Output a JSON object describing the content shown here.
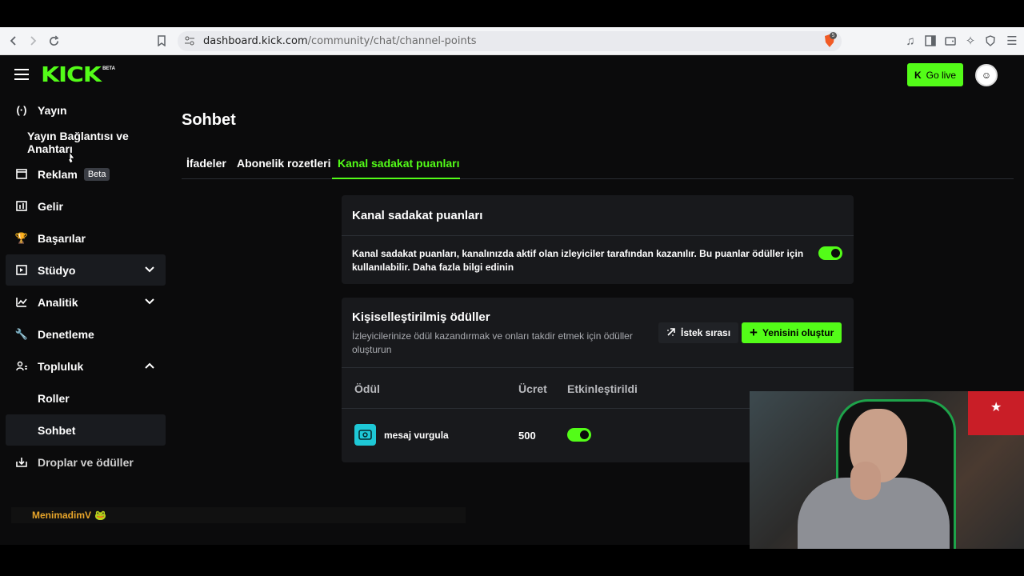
{
  "browser": {
    "url_host": "dashboard.kick.com",
    "url_path": "/community/chat/channel-points",
    "shield_badge": "5"
  },
  "header": {
    "logo_text": "KICK",
    "logo_beta": "BETA",
    "go_live_label": "Go live"
  },
  "sidebar": {
    "items": [
      {
        "label": "Yayın"
      },
      {
        "label": "Yayın Bağlantısı ve Anahtarı"
      },
      {
        "label": "Reklam",
        "badge": "Beta"
      },
      {
        "label": "Gelir"
      },
      {
        "label": "Başarılar"
      },
      {
        "label": "Stüdyo"
      },
      {
        "label": "Analitik"
      },
      {
        "label": "Denetleme"
      },
      {
        "label": "Topluluk"
      },
      {
        "label": "Roller"
      },
      {
        "label": "Sohbet"
      },
      {
        "label": "Droplar ve ödüller"
      }
    ]
  },
  "main": {
    "title": "Sohbet",
    "tabs": [
      {
        "label": "İfadeler"
      },
      {
        "label": "Abonelik rozetleri"
      },
      {
        "label": "Kanal sadakat puanları"
      }
    ],
    "loyalty_card": {
      "title": "Kanal sadakat puanları",
      "description": "Kanal sadakat puanları, kanalınızda aktif olan izleyiciler tarafından kazanılır. Bu puanlar ödüller için kullanılabilir. Daha fazla bilgi edinin",
      "enabled": true
    },
    "rewards_card": {
      "title": "Kişiselleştirilmiş ödüller",
      "subtitle": "İzleyicilerinize ödül kazandırmak ve onları takdir etmek için ödüller oluşturun",
      "queue_button": "İstek sırası",
      "create_button": "Yenisini oluştur",
      "columns": [
        "Ödül",
        "Ücret",
        "Etkinleştirildi"
      ],
      "rows": [
        {
          "name": "mesaj vurgula",
          "cost": "500",
          "enabled": true
        }
      ]
    }
  },
  "chat_overlay": {
    "username": "MenimadimV",
    "emote": "🐸"
  },
  "colors": {
    "accent": "#53fc18",
    "background": "#0b0b0c",
    "card": "#18191c"
  }
}
